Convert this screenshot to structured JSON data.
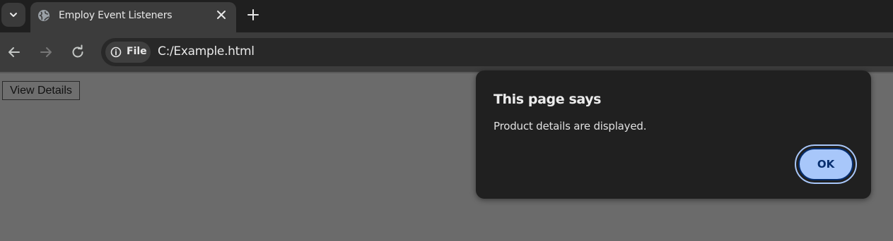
{
  "browser": {
    "tab": {
      "title": "Employ Event Listeners"
    },
    "address_chip": {
      "label": "File"
    },
    "url": "C:/Example.html"
  },
  "page": {
    "button_label": "View Details"
  },
  "dialog": {
    "title": "This page says",
    "message": "Product details are displayed.",
    "ok_label": "OK"
  },
  "colors": {
    "accent": "#a8c7fa",
    "dialog_bg": "#202020",
    "page_overlay": "#6b6b6b"
  },
  "icons": {
    "tab_search": "chevron-down-icon",
    "tab_favicon": "globe-icon",
    "tab_close": "close-icon",
    "new_tab": "plus-icon",
    "back": "arrow-left-icon",
    "forward": "arrow-right-icon",
    "reload": "reload-icon",
    "site_info": "info-icon"
  }
}
